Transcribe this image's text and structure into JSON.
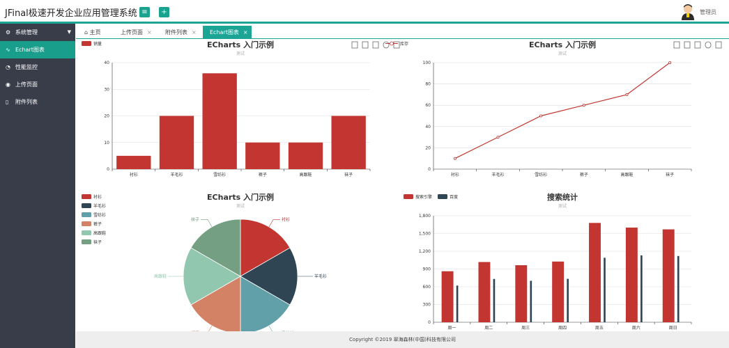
{
  "header": {
    "app_title": "JFinal极速开发企业应用管理系统",
    "menu_button_icon": "≡",
    "add_button_icon": "+",
    "user_name": "管理员"
  },
  "sidebar": {
    "items": [
      {
        "label": "系统管理",
        "icon": "gear-icon",
        "active": false,
        "has_caret": true
      },
      {
        "label": "Echart图表",
        "icon": "chart-icon",
        "active": true
      },
      {
        "label": "性能监控",
        "icon": "monitor-icon",
        "active": false
      },
      {
        "label": "上传页面",
        "icon": "eye-icon",
        "active": false
      },
      {
        "label": "附件列表",
        "icon": "file-icon",
        "active": false
      }
    ]
  },
  "tabs": [
    {
      "label": "主页",
      "icon": "home-icon",
      "closable": false,
      "active": false
    },
    {
      "label": "上传页面",
      "closable": true,
      "active": false
    },
    {
      "label": "附件列表",
      "closable": true,
      "active": false
    },
    {
      "label": "Echart图表",
      "closable": true,
      "active": true
    }
  ],
  "tab_close_glyph": "×",
  "footer": {
    "copyright": "Copyright ©2019 翠海森林(中国)科技有限公司"
  },
  "toolbox_icons": [
    "data-view-icon",
    "bar-switch-icon",
    "line-switch-icon",
    "restore-icon",
    "save-image-icon"
  ],
  "chart_data": [
    {
      "type": "bar",
      "title": "ECharts 入门示例",
      "subtitle": "测试",
      "legend": [
        "销量"
      ],
      "legend_position": "top-left",
      "categories": [
        "衬衫",
        "羊毛衫",
        "雪纺衫",
        "裤子",
        "高跟鞋",
        "袜子"
      ],
      "series": [
        {
          "name": "销量",
          "values": [
            5,
            20,
            36,
            10,
            10,
            20
          ],
          "color": "#c23531"
        }
      ],
      "ylim": [
        0,
        40
      ],
      "yticks": [
        0,
        10,
        20,
        30,
        40
      ],
      "grid": true
    },
    {
      "type": "line",
      "title": "ECharts 入门示例",
      "subtitle": "测试",
      "legend": [
        "库存"
      ],
      "legend_position": "top-left",
      "categories": [
        "衬衫",
        "羊毛衫",
        "雪纺衫",
        "裤子",
        "高跟鞋",
        "袜子"
      ],
      "series": [
        {
          "name": "库存",
          "values": [
            10,
            30,
            50,
            60,
            70,
            100
          ],
          "color": "#c23531"
        }
      ],
      "ylim": [
        0,
        100
      ],
      "yticks": [
        0,
        20,
        40,
        60,
        80,
        100
      ],
      "grid": true
    },
    {
      "type": "pie",
      "title": "ECharts 入门示例",
      "subtitle": "测试",
      "legend": [
        "衬衫",
        "羊毛衫",
        "雪纺衫",
        "裤子",
        "高跟鞋",
        "袜子"
      ],
      "legend_position": "top-left",
      "slices": [
        {
          "label": "衬衫",
          "value": 5,
          "color": "#c23531"
        },
        {
          "label": "羊毛衫",
          "value": 5,
          "color": "#2f4554"
        },
        {
          "label": "雪纺衫",
          "value": 5,
          "color": "#61a0a8"
        },
        {
          "label": "裤子",
          "value": 5,
          "color": "#d48265"
        },
        {
          "label": "高跟鞋",
          "value": 5,
          "color": "#91c7ae"
        },
        {
          "label": "袜子",
          "value": 5,
          "color": "#749f83"
        }
      ]
    },
    {
      "type": "bar",
      "title": "搜索统计",
      "subtitle": "测试",
      "legend": [
        "搜索引擎",
        "百度"
      ],
      "legend_position": "top-left",
      "categories": [
        "周一",
        "周二",
        "周三",
        "周四",
        "周五",
        "周六",
        "周日"
      ],
      "series": [
        {
          "name": "搜索引擎",
          "values": [
            862,
            1018,
            964,
            1026,
            1679,
            1600,
            1570
          ],
          "color": "#c23531"
        },
        {
          "name": "百度",
          "values": [
            620,
            732,
            701,
            734,
            1090,
            1130,
            1120
          ],
          "color": "#2f4554"
        }
      ],
      "ylim": [
        0,
        1800
      ],
      "yticks": [
        "0",
        "300",
        "600",
        "900",
        "1,200",
        "1,500",
        "1,800"
      ],
      "grid": true
    }
  ]
}
